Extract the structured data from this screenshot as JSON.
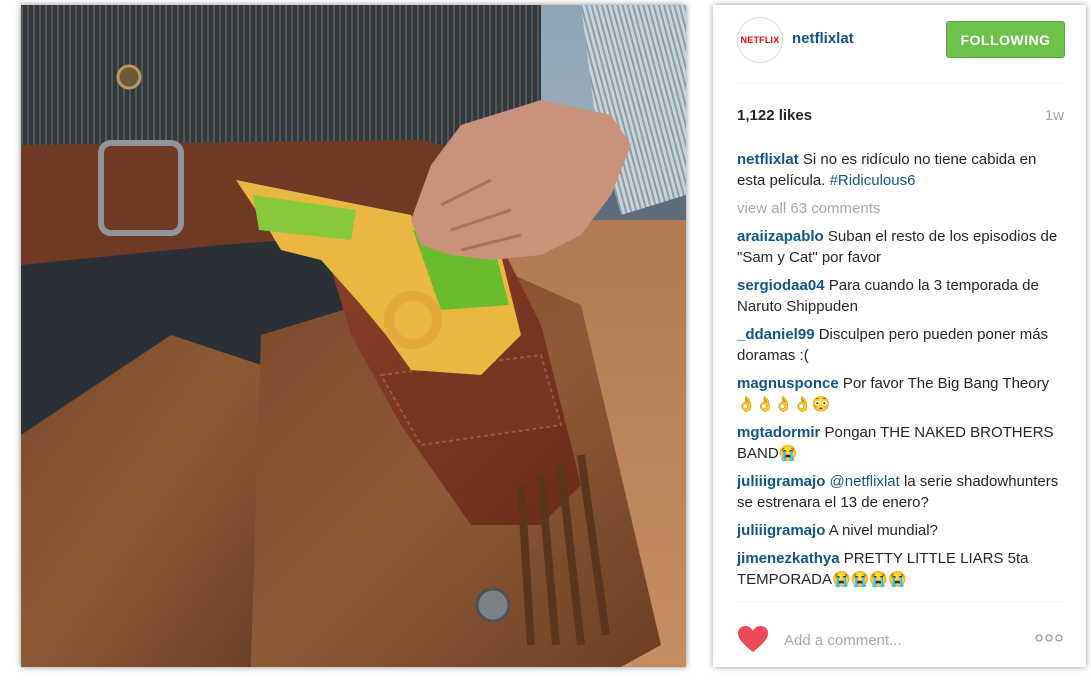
{
  "post": {
    "account": {
      "avatar_text": "NETFLIX",
      "username": "netflixlat"
    },
    "follow_button_label": "FOLLOWING",
    "likes": "1,122 likes",
    "time": "1w",
    "caption": {
      "user": "netflixlat",
      "text": "Si no es ridículo no tiene cabida en esta película.",
      "hashtag": "#Ridiculous6"
    },
    "view_all_label": "view all 63 comments",
    "comments": [
      {
        "user": "araiizapablo",
        "text": "Suban el resto de los episodios de \"Sam y Cat\" por favor"
      },
      {
        "user": "sergiodaa04",
        "text": "Para cuando la 3 temporada de Naruto Shippuden"
      },
      {
        "user": "_ddaniel99",
        "text": "Disculpen pero pueden poner más doramas :("
      },
      {
        "user": "magnusponce",
        "text": "Por favor The Big Bang Theory 👌👌👌👌😳"
      },
      {
        "user": "mgtadormir",
        "text": "Pongan THE NAKED BROTHERS BAND😭"
      },
      {
        "user": "juliiigramajo",
        "mention": "@netflixlat",
        "text": "la serie shadowhunters se estrenara el 13 de enero?"
      },
      {
        "user": "juliiigramajo",
        "text": "A nivel mundial?"
      },
      {
        "user": "jimenezkathya",
        "text": "PRETTY LITTLE LIARS 5ta TEMPORADA😭😭😭😭"
      }
    ],
    "add_comment_placeholder": "Add a comment..."
  },
  "colors": {
    "username_blue": "#125688",
    "follow_green": "#6cc24a",
    "heart_red": "#ed4956",
    "muted_gray": "#a5a7aa"
  },
  "icons": {
    "like": "heart-icon",
    "more": "ellipsis-icon"
  }
}
